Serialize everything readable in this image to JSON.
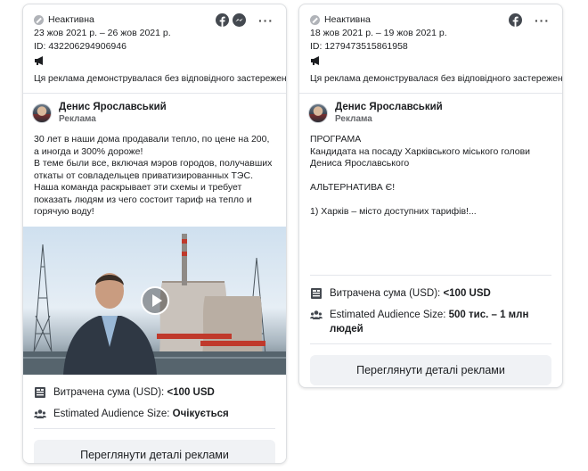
{
  "cards": [
    {
      "status": "Неактивна",
      "dates": "23 жов 2021 р. – 26 жов 2021 р.",
      "ad_id": "ID: 432206294906946",
      "platforms": [
        "facebook-icon",
        "messenger-icon"
      ],
      "disclaimer": "Ця реклама демонструвалася без відповідного застереження.",
      "advertiser": "Денис Ярославський",
      "advertiser_sub": "Реклама",
      "body": "30 лет в наши дома продавали тепло, по цене на 200, а иногда и 300% дороже!\nВ теме были все, включая мэров городов, получавших откаты от совладельцев приватизированных ТЭС.\nНаша команда раскрывает эти схемы и требует показать людям из чего состоит тариф на тепло и горячую воду!",
      "spend_label": "Витрачена сума (USD):",
      "spend_value": "<100 USD",
      "audience_label": "Estimated Audience Size:",
      "audience_value": "Очікується",
      "button": "Переглянути деталі реклами"
    },
    {
      "status": "Неактивна",
      "dates": "18 жов 2021 р. – 19 жов 2021 р.",
      "ad_id": "ID: 1279473515861958",
      "platforms": [
        "facebook-icon"
      ],
      "disclaimer": "Ця реклама демонструвалася без відповідного застереження.",
      "advertiser": "Денис Ярославський",
      "advertiser_sub": "Реклама",
      "body": "ПРОГРАМА\nКандидата на посаду Харківського міського голови\nДениса Ярославського\n\nАЛЬТЕРНАТИВА Є!\n\n1) Харків – місто доступних тарифів!...",
      "spend_label": "Витрачена сума (USD):",
      "spend_value": "<100 USD",
      "audience_label": "Estimated Audience Size:",
      "audience_value": "500 тис. – 1 млн людей",
      "button": "Переглянути деталі реклами"
    }
  ],
  "colors": {
    "facebook": "#1877f2",
    "muted": "#65676b",
    "button_bg": "#f0f2f5"
  }
}
